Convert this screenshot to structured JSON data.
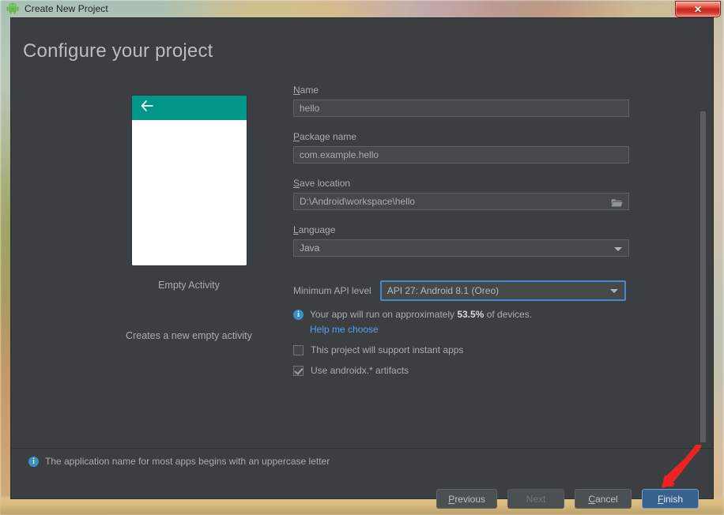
{
  "window": {
    "title": "Create New Project",
    "app_icon": "android-robot-icon",
    "close_label": "✕"
  },
  "page": {
    "title": "Configure your project"
  },
  "preview": {
    "template_name": "Empty Activity",
    "description": "Creates a new empty activity",
    "appbar_color": "#009688",
    "back_icon": "arrow-left-icon"
  },
  "form": {
    "name": {
      "label": "Name",
      "mnemonic": "N",
      "value": "hello"
    },
    "package_name": {
      "label": "Package name",
      "mnemonic": "P",
      "value": "com.example.hello"
    },
    "save_location": {
      "label": "Save location",
      "mnemonic": "S",
      "value": "D:\\Android\\workspace\\hello",
      "browse_icon": "folder-open-icon"
    },
    "language": {
      "label": "Language",
      "mnemonic": "L",
      "value": "Java"
    },
    "min_api_level": {
      "label": "Minimum API level",
      "value": "API 27: Android 8.1 (Oreo)",
      "focused": true,
      "focus_color": "#4a88c7"
    },
    "device_coverage": {
      "prefix": "Your app will run on approximately ",
      "percent": "53.5%",
      "suffix": " of devices.",
      "icon": "info-icon"
    },
    "help_link": {
      "label": "Help me choose",
      "color": "#589df6"
    },
    "checkboxes": [
      {
        "label": "This project will support instant apps",
        "checked": false
      },
      {
        "label": "Use androidx.* artifacts",
        "checked": true
      }
    ]
  },
  "status": {
    "icon": "info-icon",
    "message": "The application name for most apps begins with an uppercase letter"
  },
  "buttons": {
    "previous": {
      "label": "Previous",
      "mnemonic": "P",
      "enabled": true,
      "primary": false
    },
    "next": {
      "label": "Next",
      "enabled": false,
      "primary": false
    },
    "cancel": {
      "label": "Cancel",
      "mnemonic": "C",
      "enabled": true,
      "primary": false
    },
    "finish": {
      "label": "Finish",
      "mnemonic": "F",
      "enabled": true,
      "primary": true
    }
  },
  "annotation": {
    "type": "red-arrow",
    "color": "#ee2222",
    "points_to": "finish-button"
  }
}
